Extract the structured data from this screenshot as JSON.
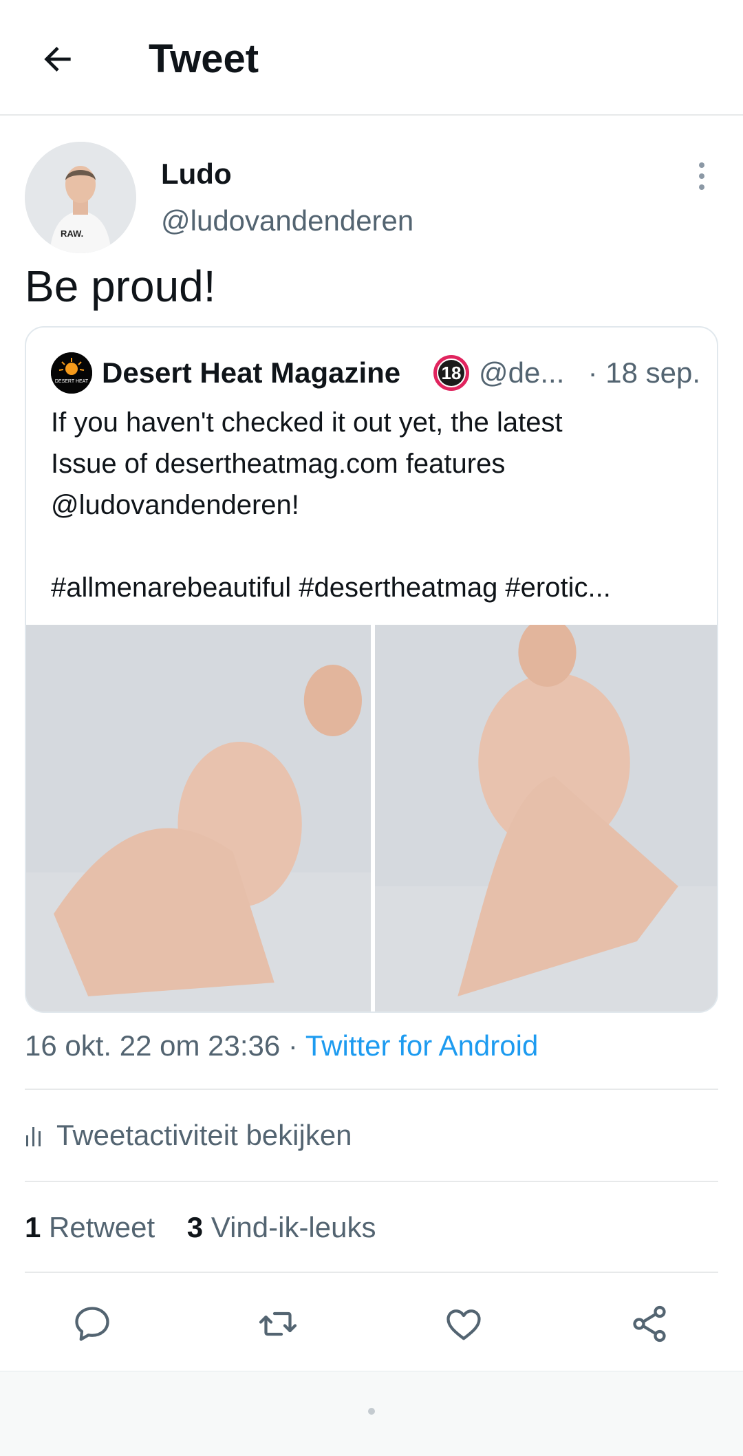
{
  "header": {
    "title": "Tweet"
  },
  "tweet": {
    "author_name": "Ludo",
    "author_handle": "@ludovandenderen",
    "text": "Be proud!",
    "timestamp": "16 okt. 22 om 23:36",
    "separator": " · ",
    "source": "Twitter for Android"
  },
  "quote": {
    "author_name": "Desert Heat Magazine",
    "badge": "18",
    "author_handle": "@de...",
    "date": "· 18 sep.",
    "body": "If you haven't checked it out yet, the latest\nIssue of desertheatmag.com features\n@ludovandenderen!\n\n#allmenarebeautiful #desertheatmag #erotic...",
    "logo_text": "DESERT HEAT"
  },
  "activity": {
    "label": "Tweetactiviteit bekijken"
  },
  "stats": {
    "retweet_count": "1",
    "retweet_label": "Retweet",
    "like_count": "3",
    "like_label": "Vind-ik-leuks"
  },
  "icons": {
    "back": "arrow-left-icon",
    "more": "vertical-dots-icon",
    "activity": "bar-chart-icon",
    "reply": "speech-bubble-icon",
    "retweet": "retweet-arrows-icon",
    "like": "heart-icon",
    "share": "share-nodes-icon"
  },
  "colors": {
    "text_primary": "#0f1419",
    "text_secondary": "#536471",
    "accent": "#1d9bf0",
    "divider": "#e7e9ea",
    "badge_ring": "#e0245e"
  }
}
